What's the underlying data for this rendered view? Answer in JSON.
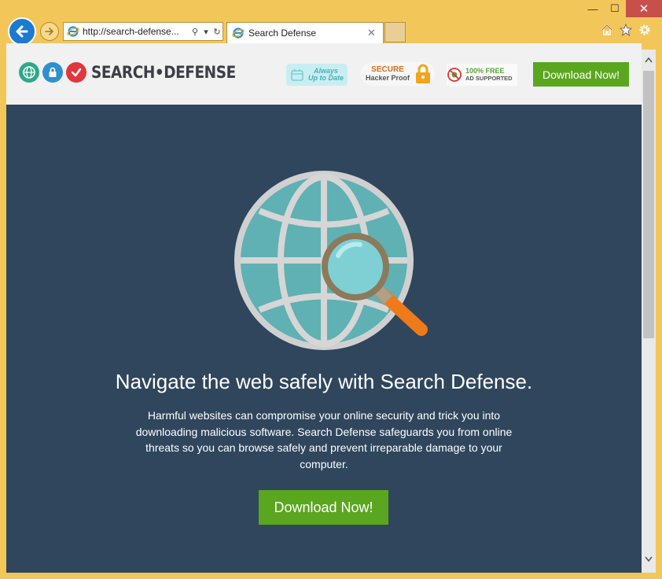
{
  "window": {
    "minimize_glyph": "—",
    "maximize_glyph": "☐",
    "close_glyph": "✕"
  },
  "browser": {
    "address": "http://search-defense...",
    "tab_title": "Search Defense",
    "icons": [
      "back-icon",
      "forward-icon",
      "search-icon",
      "dropdown-icon",
      "refresh-icon",
      "home-icon",
      "favorites-star-icon",
      "settings-gear-icon"
    ]
  },
  "page": {
    "logo_text": "SEARCH•DEFENSE",
    "badge_uptodate": {
      "line1": "Always",
      "line2": "Up to Date"
    },
    "badge_secure": {
      "line1": "SECURE",
      "line2": "Hacker Proof"
    },
    "badge_free": {
      "line1": "100% FREE",
      "line2": "AD SUPPORTED"
    },
    "header_download_label": "Download Now!",
    "headline": "Navigate the web safely with Search Defense.",
    "body": "Harmful websites can compromise your online security and trick you into downloading malicious software. Search Defense safeguards you from online threats so you can browse safely and prevent irreparable damage to your computer.",
    "main_download_label": "Download Now!"
  },
  "colors": {
    "chrome": "#f3c65a",
    "hero_bg": "#2f465d",
    "button_green": "#5ba61f",
    "globe_teal": "#5fb1b3",
    "magnifier_orange": "#ef7a1a"
  }
}
